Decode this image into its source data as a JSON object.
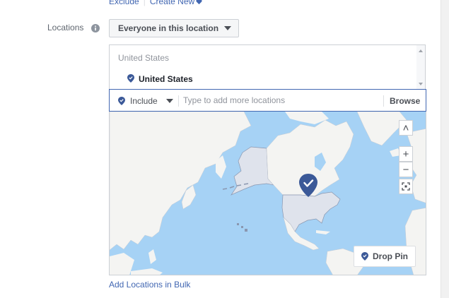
{
  "top_links": {
    "exclude": "Exclude",
    "create_new": "Create New"
  },
  "locations": {
    "label": "Locations",
    "audience_dropdown": "Everyone in this location",
    "country_header": "United States",
    "selected_item": "United States",
    "include_label": "Include",
    "search_placeholder": "Type to add more locations",
    "browse": "Browse"
  },
  "map": {
    "zoom_in": "+",
    "zoom_out": "−",
    "collapse": "˄",
    "drop_pin": "Drop Pin",
    "colors": {
      "water": "#a6d2f5",
      "land": "#f4f4f2",
      "selected_land": "#dfe3ec",
      "pin": "#3b5998"
    }
  },
  "bulk_link": "Add Locations in Bulk",
  "icons": [
    "heart-icon",
    "info-icon",
    "location-pin-icon",
    "caret-down-icon",
    "fullscreen-icon"
  ]
}
